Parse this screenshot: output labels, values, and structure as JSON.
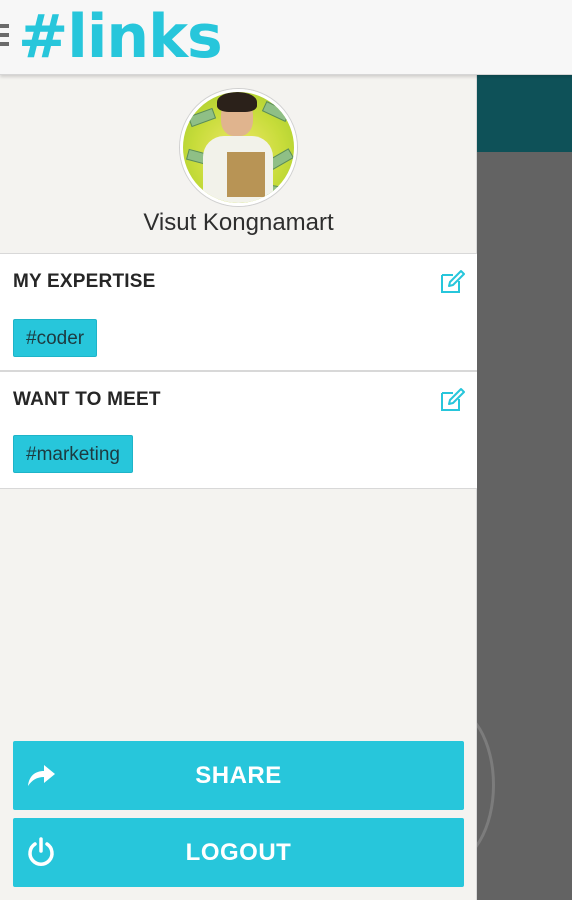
{
  "app": {
    "title": "#links"
  },
  "profile": {
    "name": "Visut Kongnamart"
  },
  "sections": {
    "expertise": {
      "heading": "MY EXPERTISE",
      "tags": [
        "#coder"
      ]
    },
    "want_to_meet": {
      "heading": "WANT TO MEET",
      "tags": [
        "#marketing"
      ]
    }
  },
  "actions": {
    "share_label": "SHARE",
    "logout_label": "LOGOUT"
  },
  "icons": {
    "menu": "hamburger-menu-icon",
    "edit": "edit-pencil-icon",
    "share": "share-arrow-icon",
    "logout": "power-icon"
  },
  "colors": {
    "accent": "#27c6db",
    "drawer_background": "#f4f3f0",
    "background_header": "#0e5158",
    "background_content": "#636363"
  }
}
